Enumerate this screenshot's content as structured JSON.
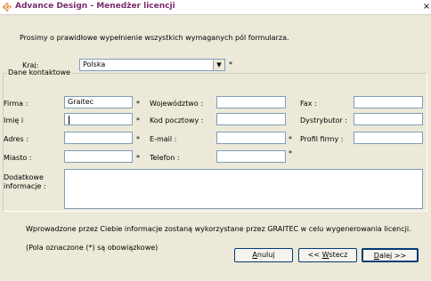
{
  "window": {
    "title": "Advance Design - Menedżer licencji",
    "close_label": "×",
    "icon": "advance-design-app-icon"
  },
  "intro": "Prosimy o prawidłowe wypełnienie wszystkich wymaganych pól formularza.",
  "country": {
    "label": "Kraj:",
    "value": "Polska",
    "asterisk": "*"
  },
  "contact": {
    "group_title": "Dane kontaktowe",
    "fields": {
      "company": {
        "label": "Firma :",
        "value": "Graitec",
        "asterisk": "*"
      },
      "name": {
        "label": "Imię i",
        "value": "",
        "asterisk": "*"
      },
      "address": {
        "label": "Adres :",
        "value": "",
        "asterisk": "*"
      },
      "city": {
        "label": "Miasto :",
        "value": "",
        "asterisk": "*"
      },
      "province": {
        "label": "Województwo :",
        "value": ""
      },
      "postal": {
        "label": "Kod pocztowy :",
        "value": "",
        "asterisk": "*"
      },
      "email": {
        "label": "E-mail :",
        "value": "",
        "asterisk": "*"
      },
      "phone": {
        "label": "Telefon :",
        "value": "",
        "asterisk": "*"
      },
      "fax": {
        "label": "Fax :",
        "value": ""
      },
      "distributor": {
        "label": "Dystrybutor :",
        "value": ""
      },
      "profile": {
        "label": "Profil firmy :",
        "value": "",
        "asterisk": "*"
      },
      "additional_line1": "Dodatkowe",
      "additional_line2": "informacje :",
      "additional_value": ""
    }
  },
  "footer": {
    "info": "Wprowadzone przez Ciebie informacje zostaną wykorzystane przez GRAITEC w celu wygenerowania licencji.",
    "required_note": "(Pola oznaczone (*) są obowiązkowe)"
  },
  "buttons": {
    "cancel": {
      "accel": "A",
      "rest": "nuluj"
    },
    "back": {
      "prefix": "<< ",
      "accel": "W",
      "rest": "stecz"
    },
    "next": {
      "accel": "D",
      "rest": "alej >>"
    }
  }
}
